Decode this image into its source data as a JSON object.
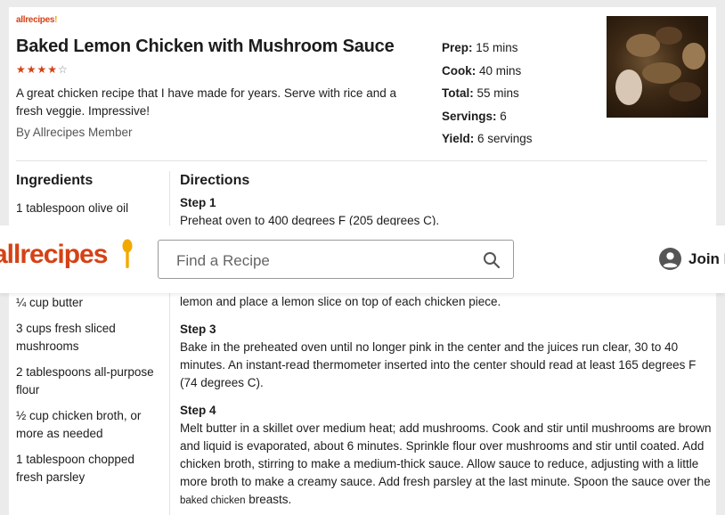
{
  "recipe": {
    "brand_small": "allrecipes",
    "title": "Baked Lemon Chicken with Mushroom Sauce",
    "rating_stars": "★★★★",
    "rating_empty": "☆",
    "description": "A great chicken recipe that I have made for years. Serve with rice and a fresh veggie. Impressive!",
    "byline": "By Allrecipes Member",
    "meta": [
      {
        "label": "Prep:",
        "value": "15 mins"
      },
      {
        "label": "Cook:",
        "value": "40 mins"
      },
      {
        "label": "Total:",
        "value": "55 mins"
      },
      {
        "label": "Servings:",
        "value": "6"
      },
      {
        "label": "Yield:",
        "value": "6 servings"
      }
    ]
  },
  "ingredients": {
    "heading": "Ingredients",
    "items": [
      "1 tablespoon olive oil",
      "¼ cup butter",
      "3 cups fresh sliced mushrooms",
      "2 tablespoons all-purpose flour",
      "½ cup chicken broth, or more as needed",
      "1 tablespoon chopped fresh parsley"
    ]
  },
  "directions": {
    "heading": "Directions",
    "step1_label": "Step 1",
    "step1_text": "Preheat oven to 400 degrees F (205 degrees C).",
    "step2_partial": "lemon and place a lemon slice on top of each chicken piece.",
    "step3_label": "Step 3",
    "step3_text": "Bake in the preheated oven until no longer pink in the center and the juices run clear, 30 to 40 minutes. An instant-read thermometer inserted into the center should read at least 165 degrees F (74 degrees C).",
    "step4_label": "Step 4",
    "step4_text_main": "Melt butter in a skillet over medium heat; add mushrooms. Cook and stir until mushrooms are brown and liquid is evaporated, about 6 minutes. Sprinkle flour over mushrooms and stir until coated. Add chicken broth, stirring to make a medium-thick sauce. Allow sauce to reduce, adjusting with a little more broth to make a creamy sauce. Add fresh parsley at the last minute. Spoon the sauce over the ",
    "step4_text_small": "baked chicken",
    "step4_text_end": " breasts."
  },
  "header": {
    "brand": "allrecipes",
    "search_placeholder": "Find a Recipe",
    "join_label": "Join N"
  },
  "colors": {
    "brand_orange": "#d54215",
    "spoon_yellow": "#f2a900"
  }
}
